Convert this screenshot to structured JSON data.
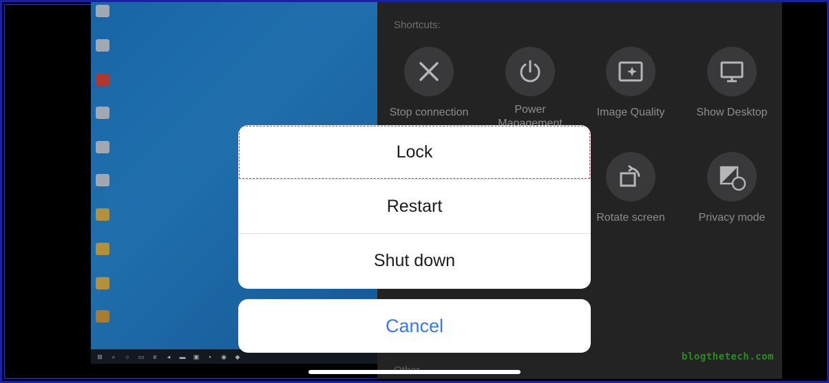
{
  "panel": {
    "title": "Shortcuts:",
    "footer": "Other",
    "shortcuts": [
      {
        "label": "Stop connection",
        "icon": "close-icon"
      },
      {
        "label": "Power\nManagement",
        "icon": "power-icon"
      },
      {
        "label": "Image Quality",
        "icon": "image-quality-icon"
      },
      {
        "label": "Show Desktop",
        "icon": "monitor-icon"
      },
      {
        "label": "Rotate screen",
        "icon": "rotate-icon"
      },
      {
        "label": "Privacy mode",
        "icon": "privacy-icon"
      }
    ]
  },
  "action_sheet": {
    "options": [
      "Lock",
      "Restart",
      "Shut down"
    ],
    "cancel": "Cancel"
  },
  "watermark": "blogthetech.com",
  "colors": {
    "accent": "#3478f6",
    "panel_bg": "#2d2d2f",
    "frame_border": "#1f2bd0"
  }
}
